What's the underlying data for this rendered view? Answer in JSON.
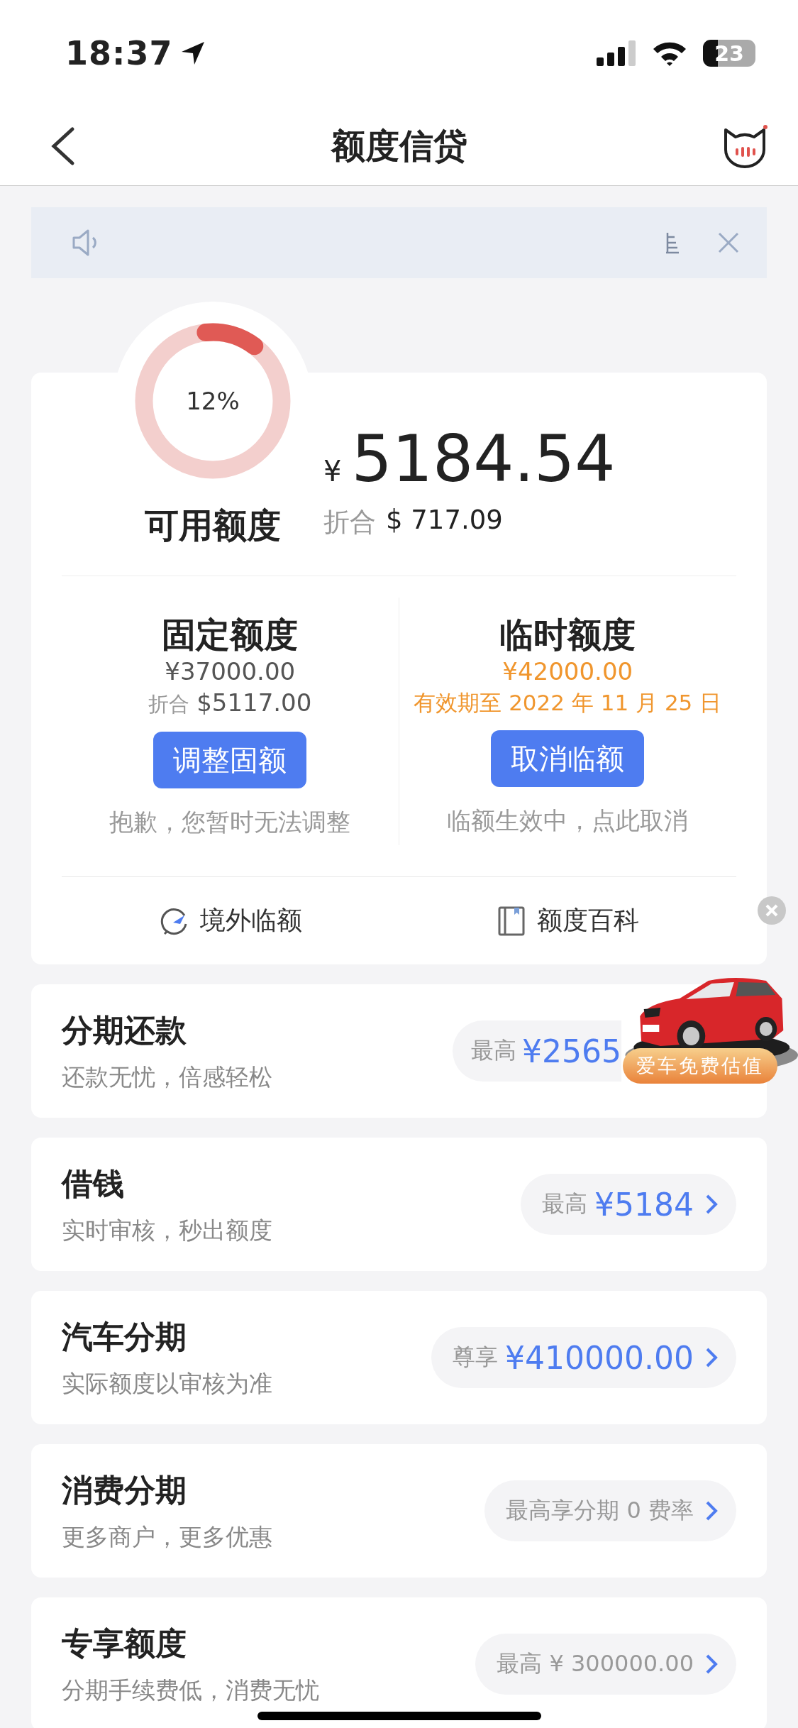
{
  "status_bar": {
    "time": "18:37",
    "battery": "23"
  },
  "nav": {
    "title": "额度信贷"
  },
  "credit": {
    "percent": "12%",
    "label": "可用额度",
    "currency": "¥",
    "amount": "5184.54",
    "converted_label": "折合",
    "converted": "$ 717.09"
  },
  "quotas": [
    {
      "kind": "fixed",
      "title": "固定额度",
      "amount": "¥37000.00",
      "converted_label": "折合",
      "converted": "$5117.00",
      "button": "调整固额",
      "note": "抱歉，您暂时无法调整"
    },
    {
      "kind": "temporary",
      "title": "临时额度",
      "amount": "¥42000.00",
      "validity": "有效期至 2022 年 11 月 25 日",
      "button": "取消临额",
      "note": "临额生效中，点此取消"
    }
  ],
  "links": [
    {
      "kind": "plane",
      "label": "境外临额"
    },
    {
      "kind": "book",
      "label": "额度百科"
    }
  ],
  "products": [
    {
      "title": "分期还款",
      "subtitle": "还款无忧，倍感轻松",
      "prefix": "最高",
      "value": "¥2565",
      "obscured": true
    },
    {
      "title": "借钱",
      "subtitle": "实时审核，秒出额度",
      "prefix": "最高",
      "value": "¥5184",
      "obscured": false
    },
    {
      "title": "汽车分期",
      "subtitle": "实际额度以审核为准",
      "prefix": "尊享",
      "value": "¥410000.00",
      "obscured": false
    },
    {
      "title": "消费分期",
      "subtitle": "更多商户，更多优惠",
      "prefix": "最高享分期 0 费率",
      "obscured": false
    },
    {
      "title": "专享额度",
      "subtitle": "分期手续费低，消费无忧",
      "prefix": "最高 ¥ 300000.00",
      "obscured": false
    }
  ],
  "ad": {
    "kind": "picture",
    "badge": "爱车免费估值"
  }
}
